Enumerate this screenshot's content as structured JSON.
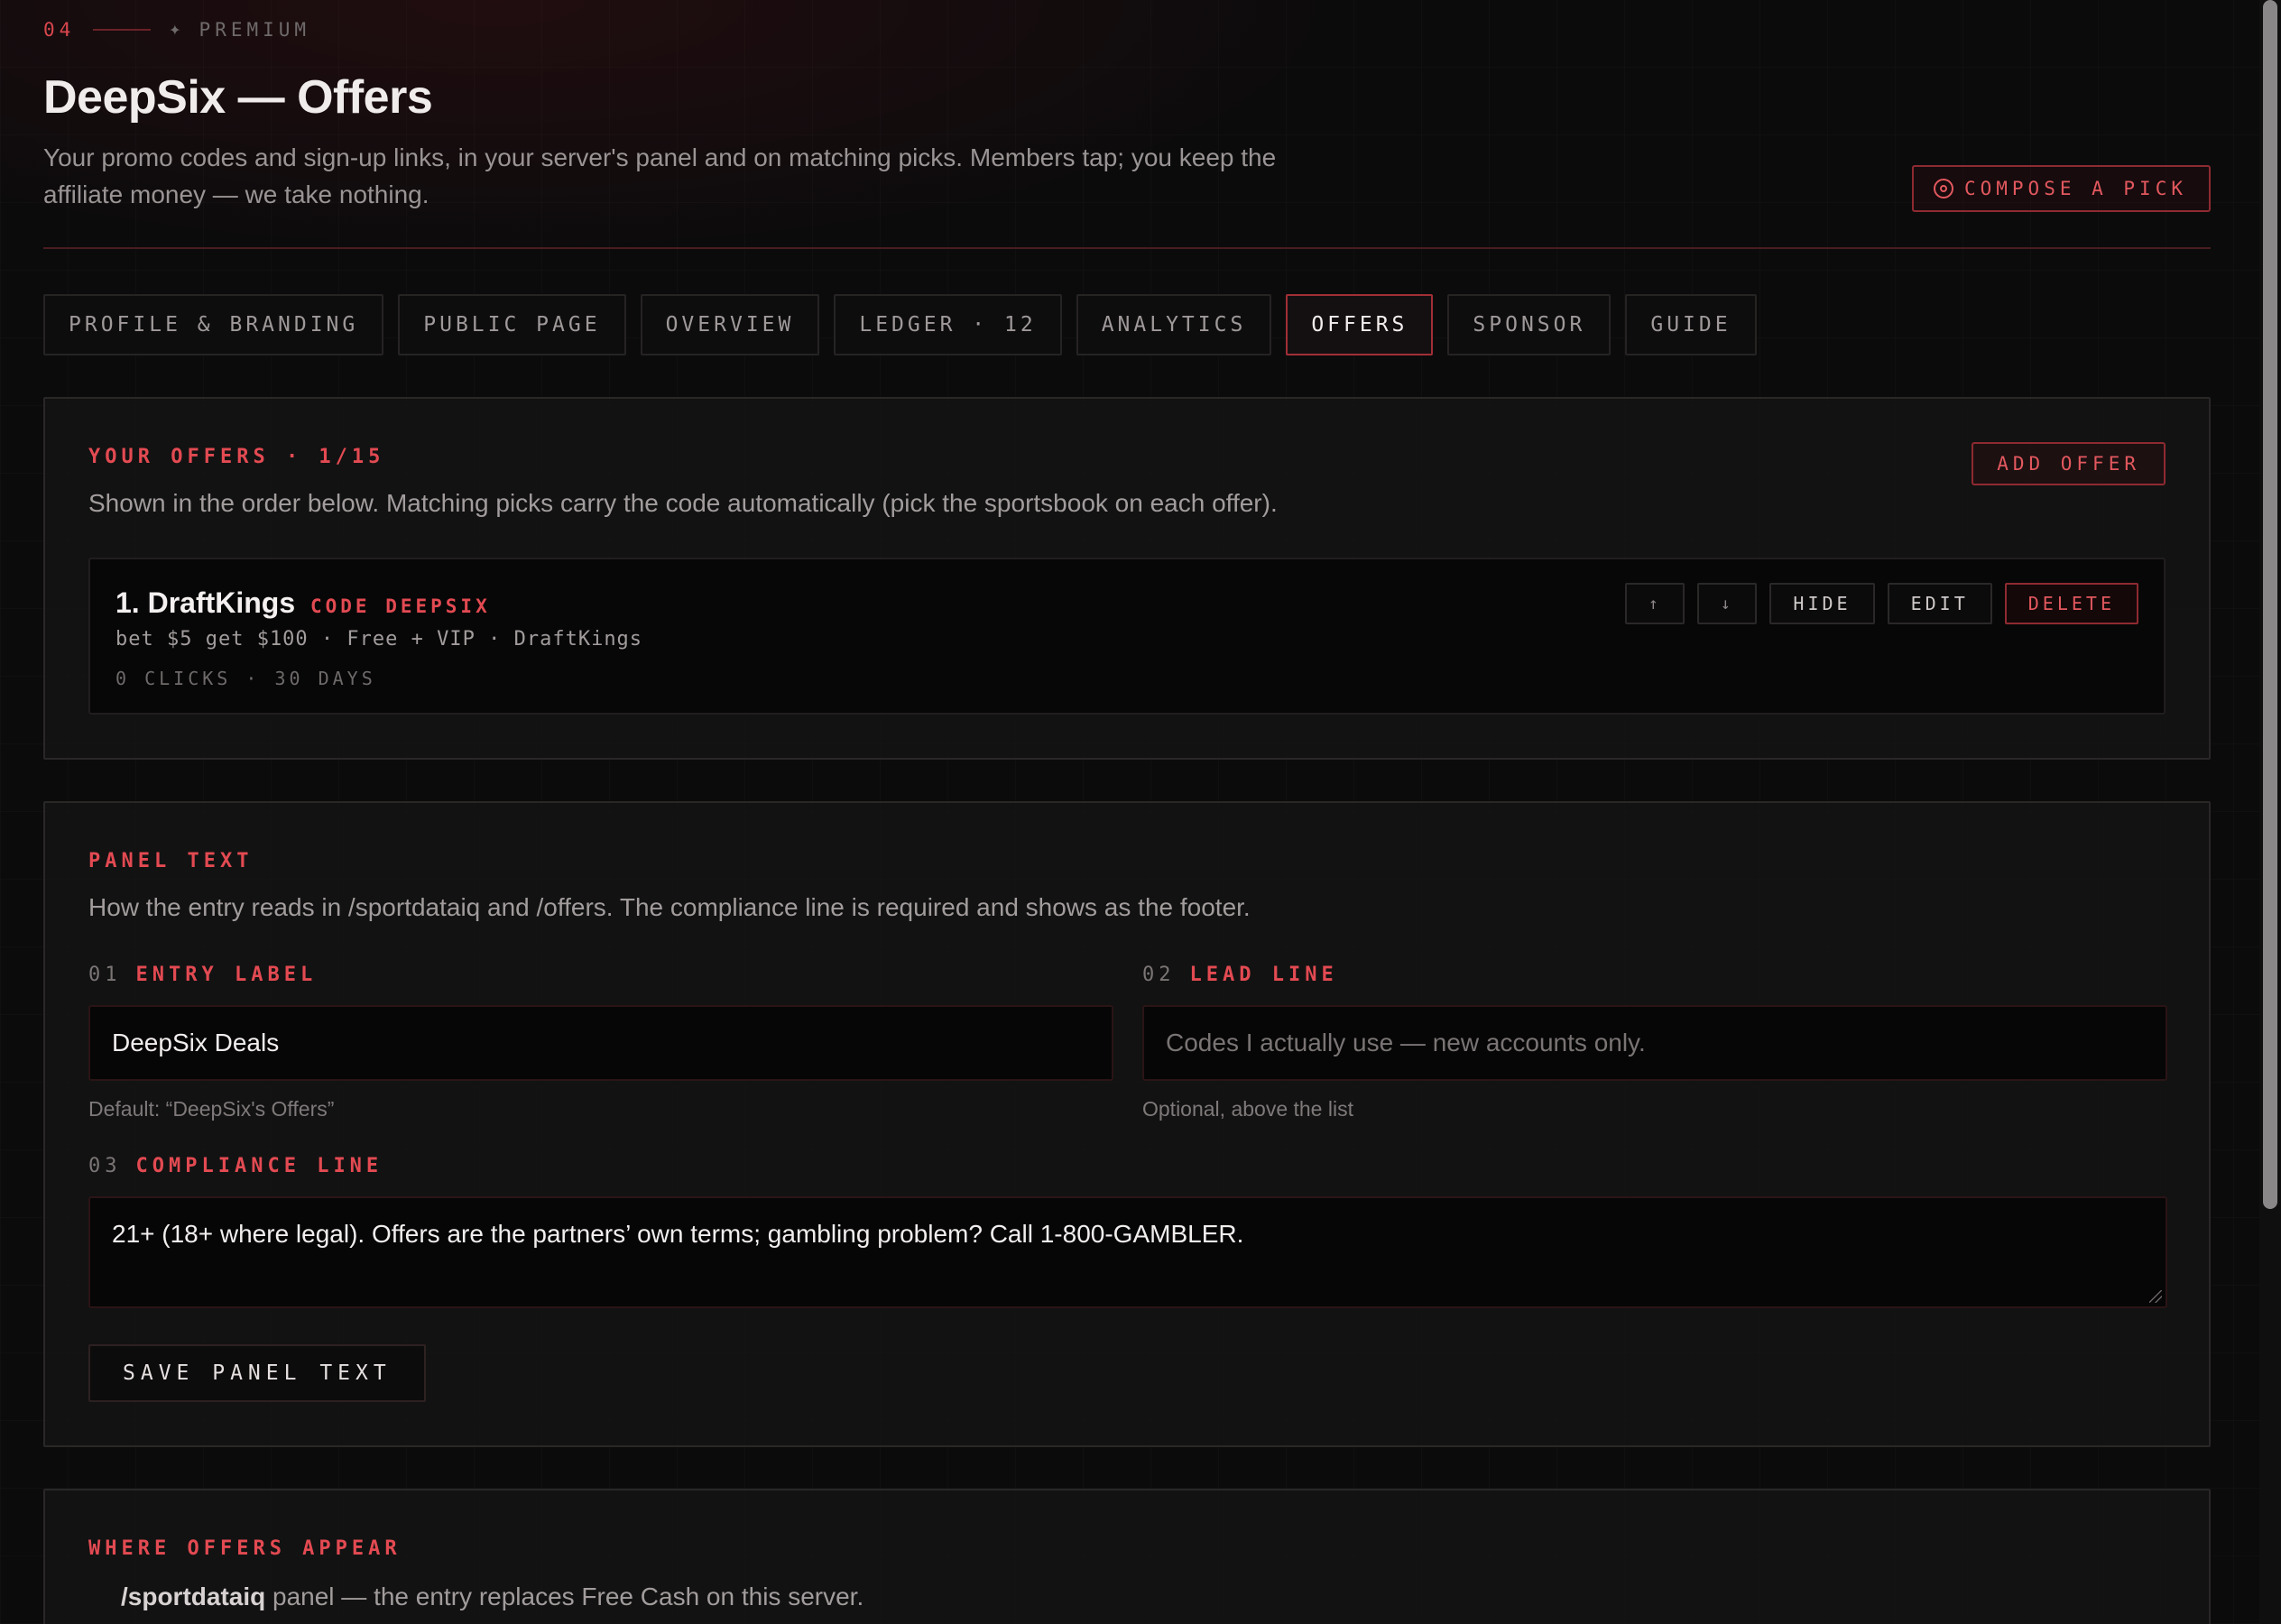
{
  "header": {
    "kicker_number": "04",
    "kicker_icon": "sparkle-icon",
    "kicker_label": "PREMIUM",
    "title": "DeepSix — Offers",
    "subtitle": "Your promo codes and sign-up links, in your server's panel and on matching picks. Members tap; you keep the affiliate money — we take nothing.",
    "compose_label": "COMPOSE A PICK",
    "compose_icon": "target-icon"
  },
  "tabs": [
    {
      "label": "PROFILE & BRANDING",
      "active": false
    },
    {
      "label": "PUBLIC PAGE",
      "active": false
    },
    {
      "label": "OVERVIEW",
      "active": false
    },
    {
      "label": "LEDGER · 12",
      "active": false
    },
    {
      "label": "ANALYTICS",
      "active": false
    },
    {
      "label": "OFFERS",
      "active": true
    },
    {
      "label": "SPONSOR",
      "active": false
    },
    {
      "label": "GUIDE",
      "active": false
    }
  ],
  "offers_panel": {
    "title": "YOUR OFFERS · 1/15",
    "description": "Shown in the order below. Matching picks carry the code automatically (pick the sportsbook on each offer).",
    "add_label": "ADD OFFER",
    "offers": [
      {
        "name": "1. DraftKings",
        "code": "CODE DEEPSIX",
        "meta": "bet $5 get $100 · Free + VIP · DraftKings",
        "stats": "0 CLICKS · 30 DAYS",
        "move_up": "↑",
        "move_down": "↓",
        "hide_label": "HIDE",
        "edit_label": "EDIT",
        "delete_label": "DELETE"
      }
    ]
  },
  "panel_text": {
    "title": "PANEL TEXT",
    "description": "How the entry reads in /sportdataiq and /offers. The compliance line is required and shows as the footer.",
    "entry_label": {
      "num": "01",
      "label": "ENTRY LABEL",
      "value": "DeepSix Deals",
      "hint": "Default: “DeepSix's Offers”"
    },
    "lead_line": {
      "num": "02",
      "label": "LEAD LINE",
      "placeholder": "Codes I actually use — new accounts only.",
      "hint": "Optional, above the list"
    },
    "compliance_line": {
      "num": "03",
      "label": "COMPLIANCE LINE",
      "value": "21+ (18+ where legal). Offers are the partners’ own terms; gambling problem? Call 1-800-GAMBLER."
    },
    "save_label": "SAVE PANEL TEXT"
  },
  "where_panel": {
    "title": "WHERE OFFERS APPEAR",
    "line_strong": "/sportdataiq",
    "line_text": " panel — the entry replaces Free Cash on this server."
  },
  "colors": {
    "accent": "#e34a52",
    "background": "#0b0b0c",
    "panel": "#141314"
  }
}
